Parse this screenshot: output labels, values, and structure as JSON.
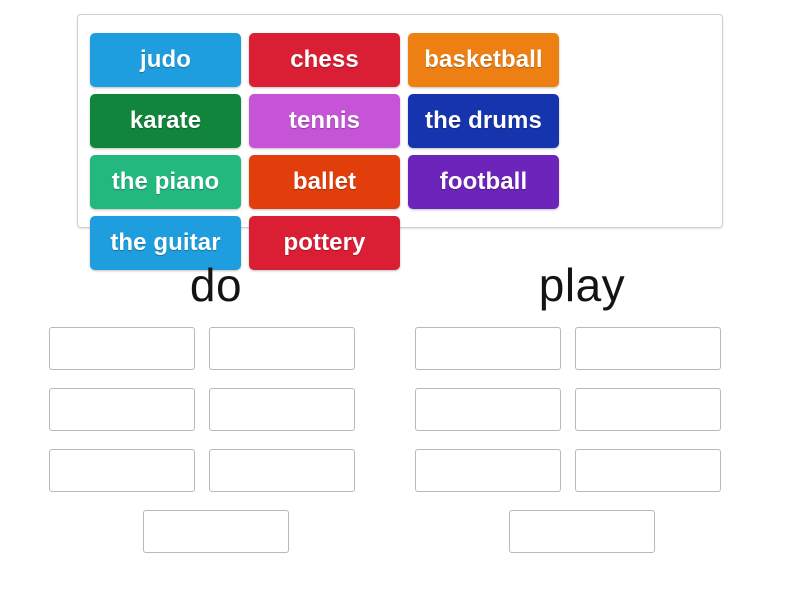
{
  "word_bank": {
    "name": "word-bank",
    "tiles": [
      {
        "label": "judo",
        "color": "#1e9ede"
      },
      {
        "label": "chess",
        "color": "#da1f35"
      },
      {
        "label": "basketball",
        "color": "#ee7f13"
      },
      {
        "label": "karate",
        "color": "#10853b"
      },
      {
        "label": "tennis",
        "color": "#c554d6"
      },
      {
        "label": "the drums",
        "color": "#1634ad"
      },
      {
        "label": "the piano",
        "color": "#22b87e"
      },
      {
        "label": "ballet",
        "color": "#e23e0c"
      },
      {
        "label": "football",
        "color": "#6d24ba"
      },
      {
        "label": "the guitar",
        "color": "#1e9ede"
      },
      {
        "label": "pottery",
        "color": "#da1f35"
      },
      {
        "label": "",
        "color": ""
      }
    ]
  },
  "columns": [
    {
      "id": "do",
      "heading": "do",
      "slots": [
        "",
        "",
        "",
        "",
        "",
        "",
        ""
      ]
    },
    {
      "id": "play",
      "heading": "play",
      "slots": [
        "",
        "",
        "",
        "",
        "",
        "",
        ""
      ]
    }
  ]
}
